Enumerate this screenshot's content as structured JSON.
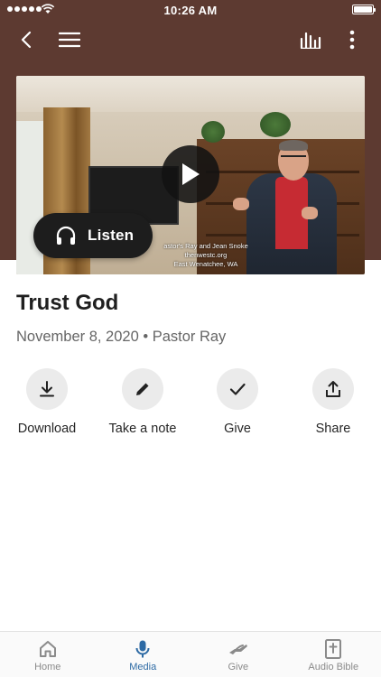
{
  "status_bar": {
    "time": "10:26 AM"
  },
  "colors": {
    "brand_brown": "#5d3a31",
    "accent_blue": "#2d6aa4",
    "action_circle": "#ebebeb"
  },
  "header": {
    "icons": [
      "back-icon",
      "menu-icon",
      "audio-bars-icon",
      "more-vertical-icon"
    ]
  },
  "video": {
    "caption_line1": "astor's Ray and Jean Snoke",
    "caption_line2": "thenwestc.org",
    "caption_line3": "East Wenatchee, WA",
    "listen_label": "Listen"
  },
  "sermon": {
    "title": "Trust God",
    "subtitle": "November 8, 2020 • Pastor Ray"
  },
  "actions": [
    {
      "label": "Download",
      "icon": "download-icon"
    },
    {
      "label": "Take a note",
      "icon": "pencil-icon"
    },
    {
      "label": "Give",
      "icon": "check-icon"
    },
    {
      "label": "Share",
      "icon": "share-icon"
    }
  ],
  "nav": [
    {
      "label": "Home",
      "icon": "home-icon",
      "active": false
    },
    {
      "label": "Media",
      "icon": "microphone-icon",
      "active": true
    },
    {
      "label": "Give",
      "icon": "give-hand-icon",
      "active": false
    },
    {
      "label": "Audio Bible",
      "icon": "bible-icon",
      "active": false
    }
  ]
}
